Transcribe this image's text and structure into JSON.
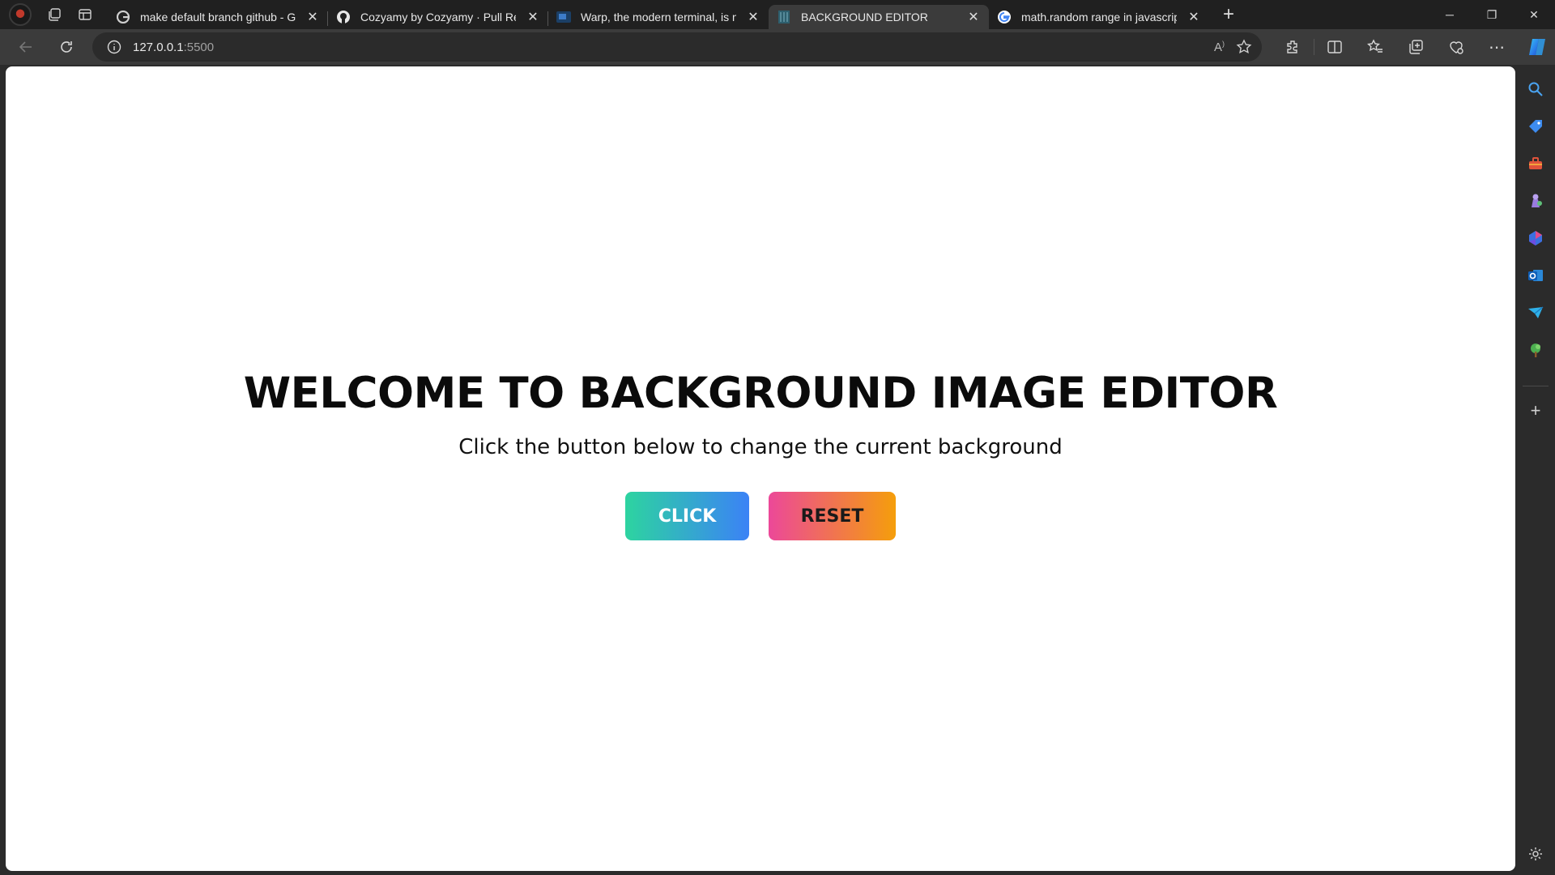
{
  "browser": {
    "tabs": [
      {
        "title": "make default branch github - Go",
        "favicon": "google-icon",
        "active": false
      },
      {
        "title": "Cozyamy by Cozyamy · Pull Requ",
        "favicon": "github-icon",
        "active": false
      },
      {
        "title": "Warp, the modern terminal, is no",
        "favicon": "warp-icon",
        "active": false
      },
      {
        "title": "BACKGROUND EDITOR",
        "favicon": "page-icon",
        "active": true
      },
      {
        "title": "math.random range in javascript",
        "favicon": "google-icon",
        "active": false
      }
    ],
    "address": {
      "host": "127.0.0.1",
      "port": ":5500"
    }
  },
  "page": {
    "title": "WELCOME TO BACKGROUND IMAGE EDITOR",
    "subtitle": "Click the button below to change the current background",
    "click_label": "CLICK",
    "reset_label": "RESET"
  },
  "colors": {
    "click_gradient": [
      "#2dd4a0",
      "#3b82f6"
    ],
    "reset_gradient": [
      "#ec4899",
      "#f59e0b"
    ]
  }
}
